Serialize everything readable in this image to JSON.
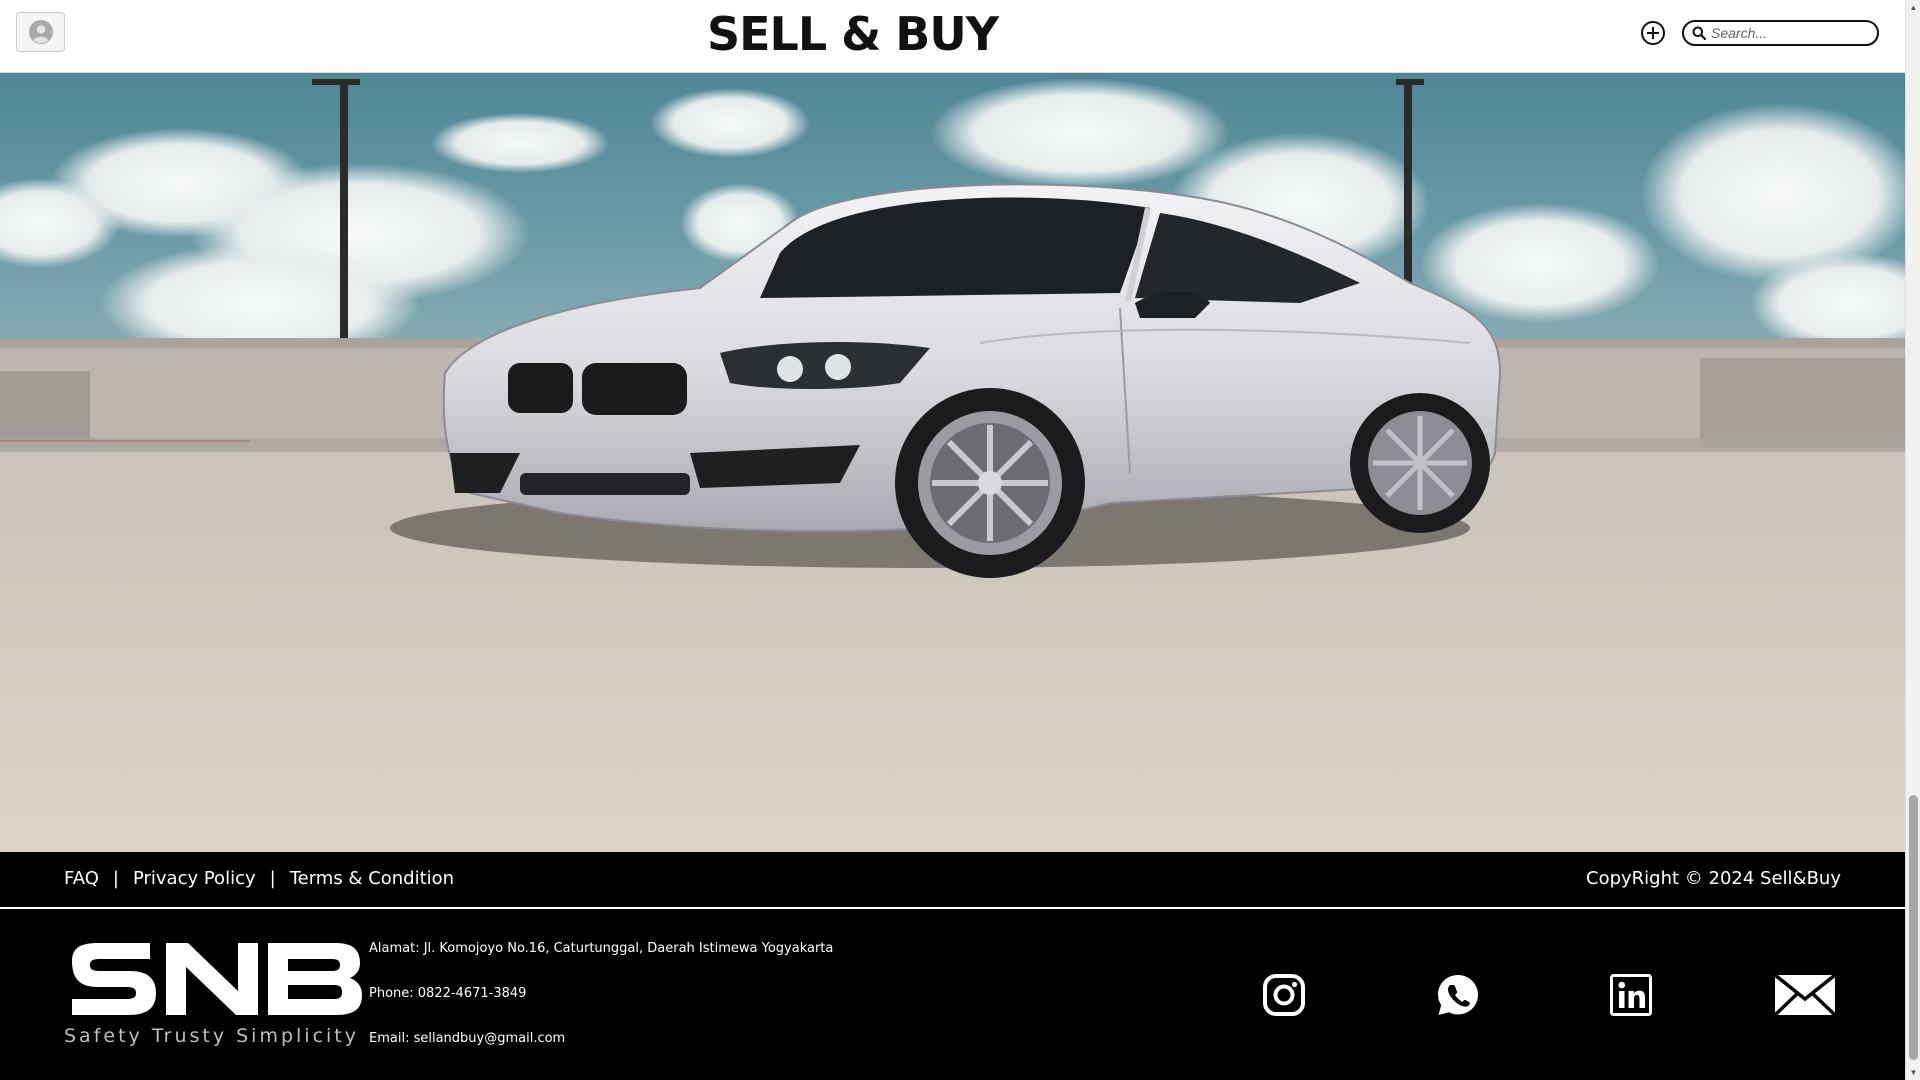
{
  "header": {
    "title": "SELL & BUY",
    "search_placeholder": "Search...",
    "profile_icon": "user-avatar-icon",
    "add_icon": "plus-circle-icon",
    "search_icon": "search-icon"
  },
  "hero": {
    "image": "white BMW coupe on rooftop parking lot under cloudy sky"
  },
  "footer": {
    "links": [
      {
        "label": "FAQ"
      },
      {
        "label": "Privacy Policy"
      },
      {
        "label": "Terms & Condition"
      }
    ],
    "separator": "|",
    "copyright": "CopyRight © 2024 Sell&Buy",
    "logo_text": "SNB",
    "tagline": "Safety Trusty Simplicity",
    "address": "Alamat: Jl. Komojoyo No.16, Caturtunggal, Daerah Istimewa Yogyakarta",
    "phone": "Phone: 0822-4671-3849",
    "email": "Email: sellandbuy@gmail.com",
    "social": [
      {
        "icon": "instagram-icon"
      },
      {
        "icon": "whatsapp-icon"
      },
      {
        "icon": "linkedin-icon"
      },
      {
        "icon": "email-icon"
      }
    ]
  },
  "colors": {
    "header_bg": "#ffffff",
    "footer_bg": "#000000",
    "footer_text": "#ffffff",
    "sky": "#5b8e9c"
  }
}
